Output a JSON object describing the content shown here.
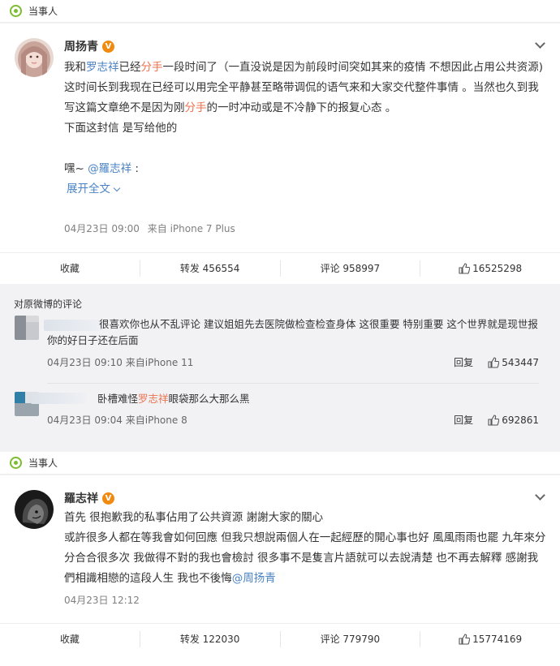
{
  "post1": {
    "tag": "当事人",
    "author": "周扬青",
    "verified_mark": "V",
    "para1_parts": [
      "我和",
      "罗志祥",
      "已经",
      "分手",
      "一段时间了（一直没说是因为前段时间突如其来的疫情 不想因此占用公共资源)"
    ],
    "para2_parts": [
      "这时间长到我现在已经可以用完全平静甚至略带调侃的语气来和大家交代整件事情 。当然也久到我写这篇文章绝不是因为刚",
      "分手",
      "的一时冲动或是不冷静下的报复心态 。"
    ],
    "para3": "下面这封信 是写给他的",
    "para4_prefix": "嘿~ ",
    "para4_mention": "@羅志祥",
    "para4_suffix": " :",
    "expand": "展开全文",
    "time": "04月23日 09:00",
    "source": "来自 iPhone 7 Plus",
    "actions": {
      "collect": "收藏",
      "forward": "转发 456554",
      "comment": "评论 958997",
      "like": "16525298"
    }
  },
  "comments": {
    "header": "对原微博的评论",
    "items": [
      {
        "text": "很喜欢你也从不乱评论 建议姐姐先去医院做检查检查身体 这很重要 特别重要 这个世界就是现世报 你的好日子还在后面",
        "time": "04月23日 09:10 来自iPhone 11",
        "reply": "回复",
        "likes": "543447"
      },
      {
        "text_parts": [
          "卧槽难怪",
          "罗志祥",
          "眼袋那么大那么黑"
        ],
        "time": "04月23日 09:04 来自iPhone 8",
        "reply": "回复",
        "likes": "692861"
      }
    ]
  },
  "post2": {
    "tag": "当事人",
    "author": "羅志祥",
    "verified_mark": "V",
    "text": "首先 很抱歉我的私事佔用了公共資源 謝謝大家的關心",
    "text2": "或許很多人都在等我會如何回應 但我只想說兩個人在一起經歷的開心事也好 風風雨雨也罷 九年來分分合合很多次 我做得不對的我也會檢討 很多事不是隻言片語就可以去說清楚 也不再去解釋 感謝我們相識相戀的這段人生 我也不後悔",
    "mention": "@周扬青",
    "time": "04月23日 12:12",
    "actions": {
      "collect": "收藏",
      "forward": "转发 122030",
      "comment": "评论 779790",
      "like": "15774169"
    }
  }
}
